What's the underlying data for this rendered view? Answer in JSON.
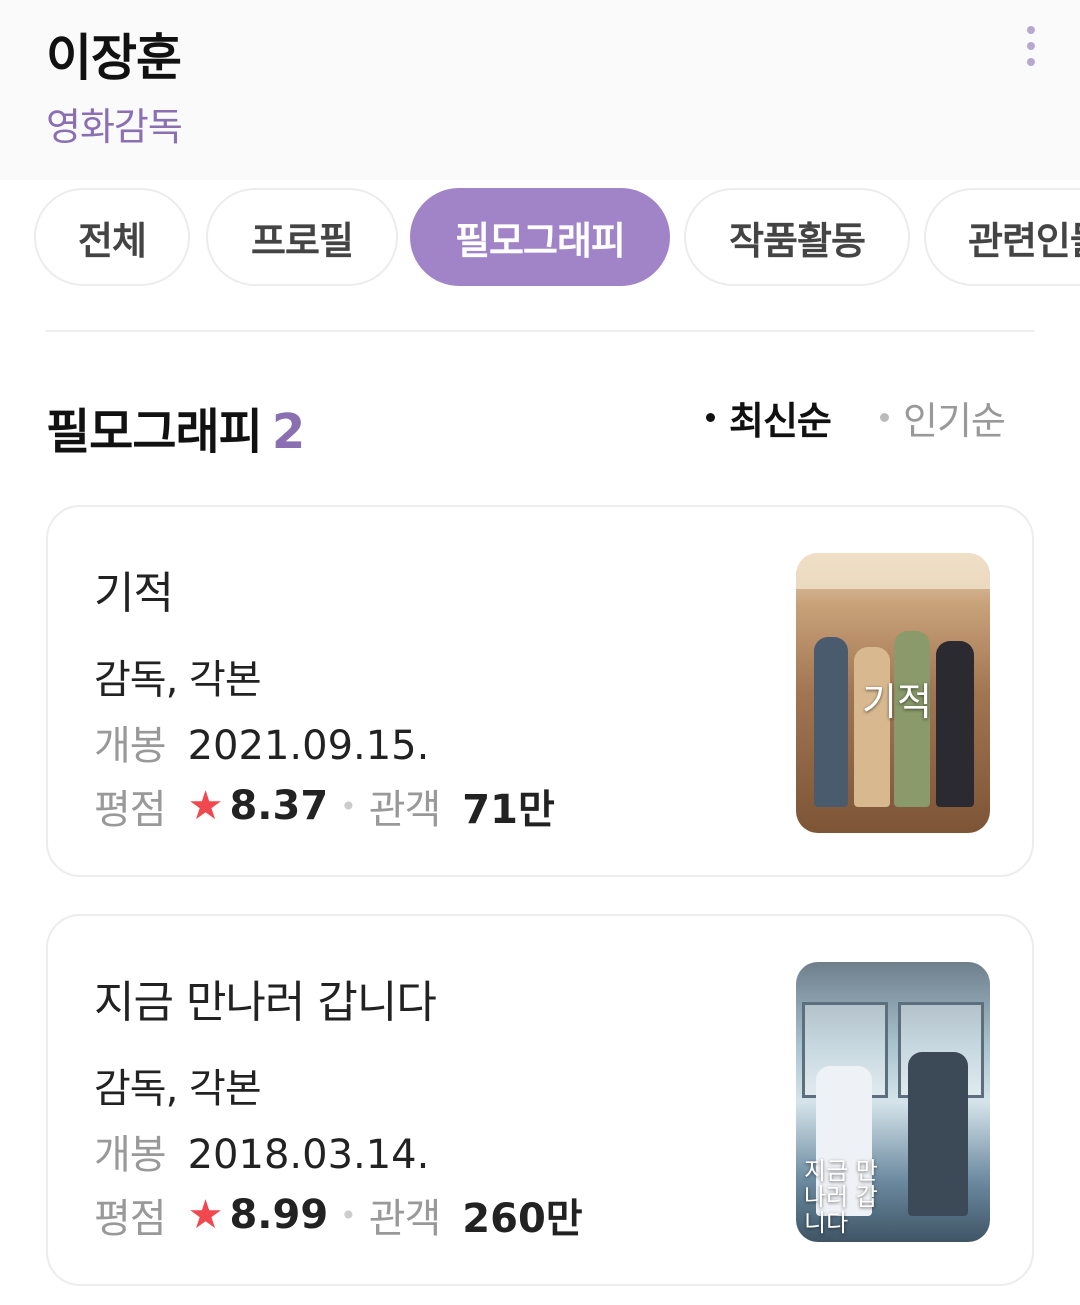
{
  "header": {
    "name": "이장훈",
    "role": "영화감독",
    "more_icon": "more-vertical-icon"
  },
  "tabs": [
    {
      "label": "전체",
      "active": false
    },
    {
      "label": "프로필",
      "active": false
    },
    {
      "label": "필모그래피",
      "active": true
    },
    {
      "label": "작품활동",
      "active": false
    },
    {
      "label": "관련인물",
      "active": false
    }
  ],
  "section": {
    "title": "필모그래피",
    "count": "2",
    "sort_options": [
      {
        "label": "최신순",
        "selected": true
      },
      {
        "label": "인기순",
        "selected": false
      }
    ]
  },
  "films": [
    {
      "title": "기적",
      "credit": "감독, 각본",
      "release_label": "개봉",
      "release_date": "2021.09.15.",
      "rating_label": "평점",
      "rating": "8.37",
      "audience_label": "관객",
      "audience": "71만",
      "poster_title": "기적"
    },
    {
      "title": "지금 만나러 갑니다",
      "credit": "감독, 각본",
      "release_label": "개봉",
      "release_date": "2018.03.14.",
      "rating_label": "평점",
      "rating": "8.99",
      "audience_label": "관객",
      "audience": "260만",
      "poster_title": "지금 만나러 갑니다"
    }
  ],
  "colors": {
    "accent": "#a184c8",
    "role_text": "#8a6fb3",
    "star": "#f0484e"
  }
}
